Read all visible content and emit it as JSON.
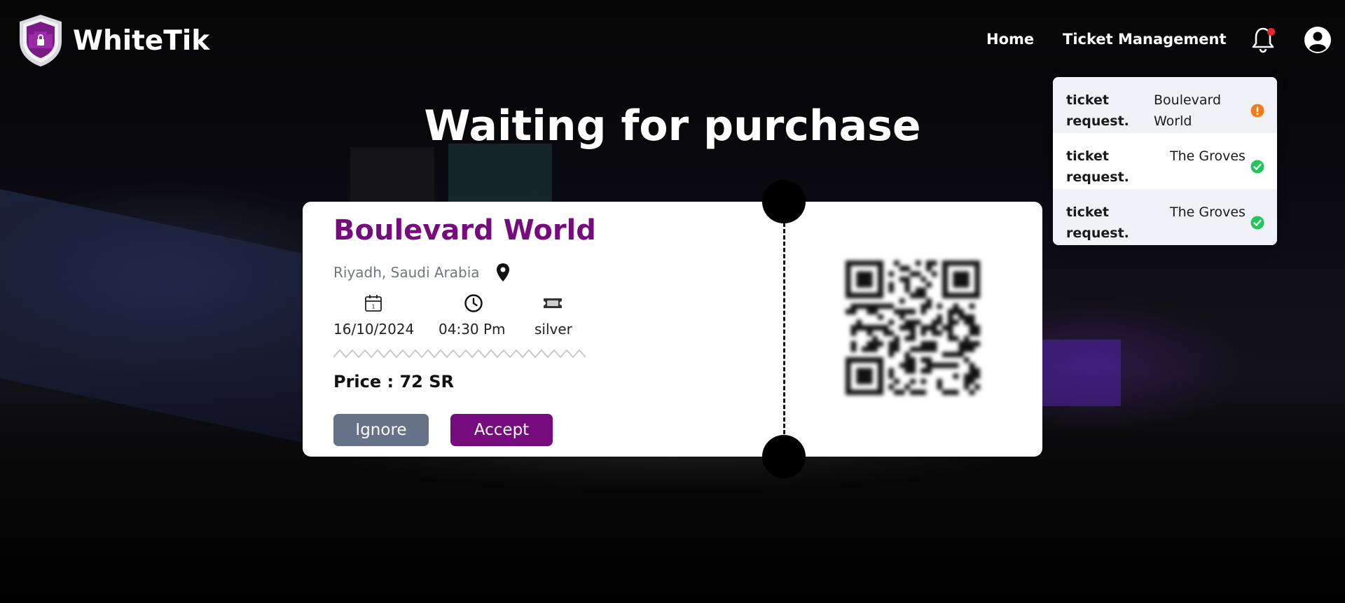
{
  "app": {
    "brand": "WhiteTik"
  },
  "nav": {
    "home": "Home",
    "ticket_management": "Ticket Management",
    "bell_icon": "bell-icon",
    "account_icon": "user-circle-icon",
    "has_unread": true
  },
  "notifications": [
    {
      "type": "ticket request.",
      "place": "Boulevard World",
      "status": "pending",
      "status_color": "#f27b1b"
    },
    {
      "type": "ticket request.",
      "place": "The Groves",
      "status": "accepted",
      "status_color": "#22c55e"
    },
    {
      "type": "ticket request.",
      "place": "The Groves",
      "status": "accepted",
      "status_color": "#22c55e"
    }
  ],
  "page": {
    "title": "Waiting for purchase"
  },
  "ticket": {
    "event_name": "Boulevard World",
    "location": "Riyadh, Saudi Arabia",
    "date": "16/10/2024",
    "time": "04:30 Pm",
    "tier": "silver",
    "price": "Price : 72 SR",
    "ignore_label": "Ignore",
    "accept_label": "Accept",
    "icons": {
      "location": "map-pin-icon",
      "date": "calendar-icon",
      "time": "clock-icon",
      "tier": "ticket-icon",
      "code": "qr-code-icon"
    }
  },
  "colors": {
    "brand_purple": "#760b7d",
    "ignore_gray": "#667288",
    "notification_dot": "#e5262d"
  }
}
